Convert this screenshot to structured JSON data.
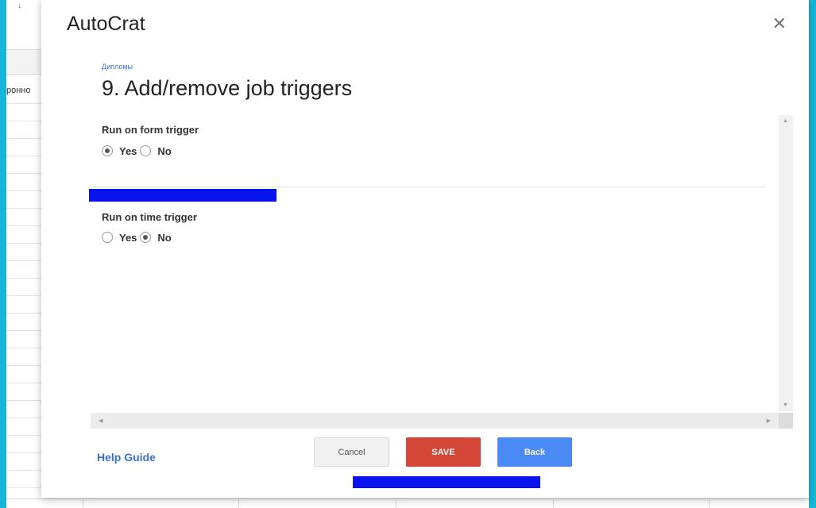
{
  "app": {
    "title": "AutoCrat",
    "close_glyph": "✕"
  },
  "sheet": {
    "cell_text": "роннo",
    "corner_glyph": "↓"
  },
  "breadcrumb": "Дипломы",
  "step_title": "9. Add/remove job triggers",
  "triggers": {
    "form": {
      "label": "Run on form trigger",
      "yes": "Yes",
      "no": "No",
      "selected": "Yes"
    },
    "time": {
      "label": "Run on time trigger",
      "yes": "Yes",
      "no": "No",
      "selected": "No"
    }
  },
  "footer": {
    "help_label": "Help Guide",
    "cancel_label": "Cancel",
    "save_label": "SAVE",
    "back_label": "Back"
  },
  "colors": {
    "frame": "#16b6d8",
    "save": "#d44638",
    "back": "#4a8af4",
    "link": "#3b6fd8",
    "redaction": "#0a14ee"
  },
  "icons": {
    "close": "close-icon",
    "scroll_up": "triangle-up-icon",
    "scroll_down": "triangle-down-icon",
    "scroll_left": "triangle-left-icon",
    "scroll_right": "triangle-right-icon"
  }
}
